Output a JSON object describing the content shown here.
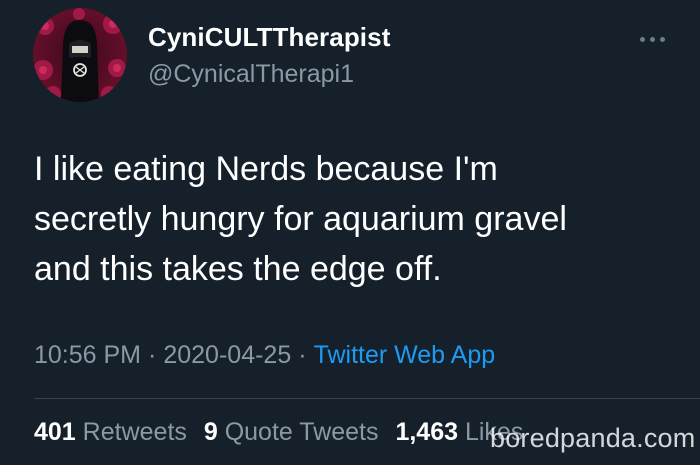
{
  "tweet": {
    "author": {
      "display_name": "CyniCULTTherapist",
      "handle": "@CynicalTherapi1",
      "avatar_icon": "avatar-hooded-figure-icon"
    },
    "more_icon": "more-options-icon",
    "text": "I like eating Nerds because I'm\nsecretly hungry for aquarium gravel\nand this takes the edge off.",
    "meta": {
      "time": "10:56 PM",
      "separator": "·",
      "date": "2020-04-25",
      "source": "Twitter Web App"
    },
    "stats": {
      "retweets_count": "401",
      "retweets_label": "Retweets",
      "quote_tweets_count": "9",
      "quote_tweets_label": "Quote Tweets",
      "likes_count": "1,463",
      "likes_label": "Likes"
    }
  },
  "watermark": "boredpanda.com",
  "colors": {
    "background": "#15202b",
    "primary_text": "#ffffff",
    "secondary_text": "#8b98a5",
    "link": "#1d9bf0",
    "divider": "#38444d"
  }
}
